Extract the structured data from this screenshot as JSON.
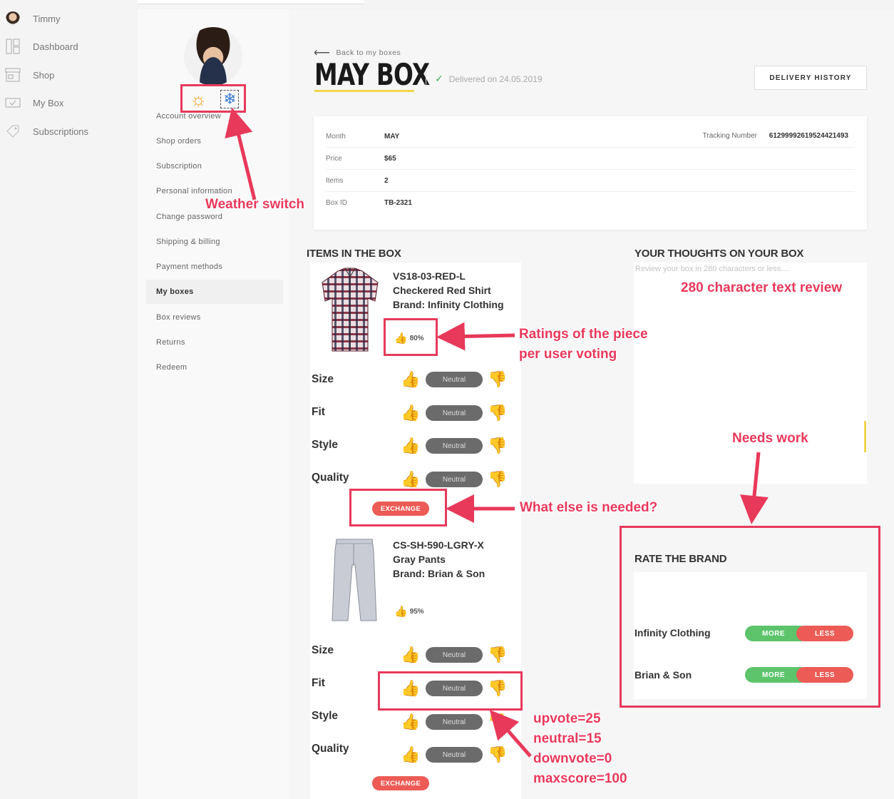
{
  "appnav": {
    "user": "Timmy",
    "items": [
      "Dashboard",
      "Shop",
      "My Box",
      "Subscriptions"
    ]
  },
  "sidemenu": [
    "Account overview",
    "Shop orders",
    "Subscription",
    "Personal information",
    "Change password",
    "Shipping & billing",
    "Payment methods",
    "My boxes",
    "Box reviews",
    "Returns",
    "Redeem"
  ],
  "header": {
    "back_label": "Back to my boxes",
    "title": "MAY BOX",
    "delivered": "Delivered on 24.05.2019",
    "history_button": "DELIVERY HISTORY"
  },
  "info": {
    "month_label": "Month",
    "month": "MAY",
    "price_label": "Price",
    "price": "$65",
    "items_label": "Items",
    "items": "2",
    "boxid_label": "Box ID",
    "boxid": "TB-2321",
    "tracking_label": "Tracking Number",
    "tracking": "61299992619524421493"
  },
  "items_section": {
    "title": "ITEMS IN THE BOX",
    "attributes": [
      "Size",
      "Fit",
      "Style",
      "Quality"
    ],
    "neutral_label": "Neutral",
    "exchange_label": "EXCHANGE",
    "items": [
      {
        "sku": "VS18-03-RED-L",
        "name": "Checkered Red Shirt",
        "brand": "Brand: Infinity Clothing",
        "rating": "80%"
      },
      {
        "sku": "CS-SH-590-LGRY-X",
        "name": "Gray Pants",
        "brand": "Brand: Brian & Son",
        "rating": "95%"
      }
    ]
  },
  "review": {
    "title": "YOUR THOUGHTS ON YOUR BOX",
    "placeholder": "Review your box in 280 characters or less...."
  },
  "rate_brand": {
    "title": "RATE THE BRAND",
    "more_label": "MORE",
    "less_label": "LESS",
    "brands": [
      "Infinity Clothing",
      "Brian & Son"
    ]
  },
  "annotations": {
    "weather": "Weather switch",
    "text_review": "280 character text review",
    "ratings_line1": "Ratings of the piece",
    "ratings_line2": "per user voting",
    "needs_work": "Needs work",
    "what_else": "What else is needed?",
    "scores": [
      "upvote=25",
      "neutral=15",
      "downvote=0",
      "maxscore=100"
    ]
  },
  "colors": {
    "accent_red": "#e8395b",
    "exchange": "#ec5b55",
    "more_green": "#5dc46b",
    "underline_yellow": "#f1d54c"
  }
}
